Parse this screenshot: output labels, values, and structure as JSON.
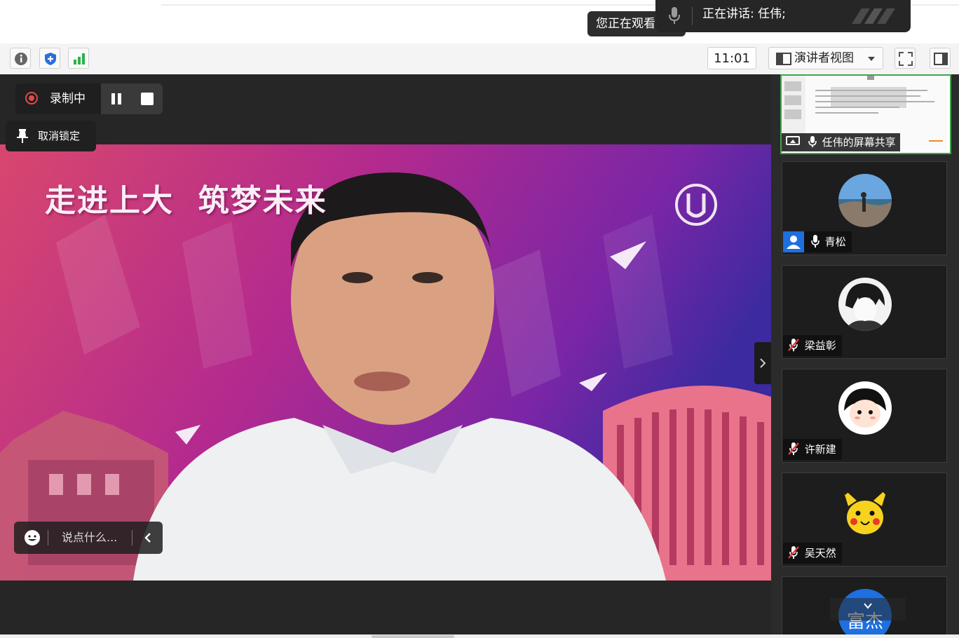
{
  "top_notice": {
    "watching_text": "您正在观看",
    "speaking_text": "正在讲话: 任伟;"
  },
  "toolbar": {
    "time": "11:01",
    "view_mode_label": "演讲者视图"
  },
  "stage": {
    "recording_label": "录制中",
    "unlock_label": "取消锁定",
    "chat_placeholder": "说点什么...",
    "banner_slogan": "走进上大  筑梦未来"
  },
  "participants": {
    "screen_share_label": "任伟的屏幕共享",
    "tiles": [
      {
        "name": "青松",
        "muted": false,
        "icon": "user-icon"
      },
      {
        "name": "梁益彰",
        "muted": true,
        "icon": "mic-off-icon"
      },
      {
        "name": "许新建",
        "muted": true,
        "icon": "mic-off-icon"
      },
      {
        "name": "吴天然",
        "muted": true,
        "icon": "mic-off-icon"
      },
      {
        "name": "富杰",
        "muted": null,
        "icon": "avatar-initials"
      }
    ]
  },
  "colors": {
    "recording_red": "#e14b4b",
    "active_green": "#3fa54a",
    "panel_dark": "#262626",
    "banner_purple": "#8a2aa6",
    "banner_magenta": "#d83a7a"
  }
}
